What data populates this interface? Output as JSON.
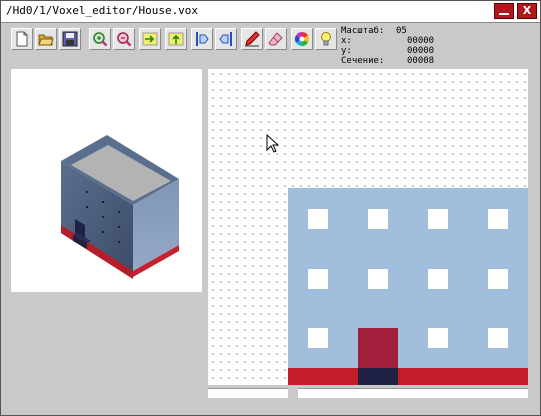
{
  "window": {
    "title": "/Hd0/1/Voxel_editor/House.vox",
    "close_glyph": "X"
  },
  "toolbar": {
    "tools": [
      {
        "name": "new-file",
        "icon": "new-file-icon"
      },
      {
        "name": "open-file",
        "icon": "open-folder-icon"
      },
      {
        "name": "save-file",
        "icon": "floppy-disk-icon"
      },
      {
        "name": "zoom-in",
        "icon": "zoom-in-icon"
      },
      {
        "name": "zoom-out",
        "icon": "zoom-out-icon"
      },
      {
        "name": "move-right",
        "icon": "arrow-right-icon"
      },
      {
        "name": "move-up",
        "icon": "arrow-up-icon"
      },
      {
        "name": "slice-forward",
        "icon": "slice-forward-icon"
      },
      {
        "name": "slice-back",
        "icon": "slice-back-icon"
      },
      {
        "name": "pencil",
        "icon": "pencil-icon"
      },
      {
        "name": "eraser",
        "icon": "eraser-icon"
      },
      {
        "name": "palette",
        "icon": "color-palette-icon"
      },
      {
        "name": "light",
        "icon": "light-bulb-icon"
      }
    ]
  },
  "status": {
    "scale_label": "Масштаб:",
    "scale_value": "05",
    "x_label": "x:",
    "x_value": "00000",
    "y_label": "y:",
    "y_value": "00000",
    "section_label": "Сечение:",
    "section_value": "00008"
  },
  "colors": {
    "wall": "#a2bedd",
    "window": "#ffffff",
    "base": "#c41e2a",
    "door": "#a2203e",
    "step": "#1f2145",
    "roof": "#b0b0b0",
    "grid_dot": "#b9b9b9"
  }
}
